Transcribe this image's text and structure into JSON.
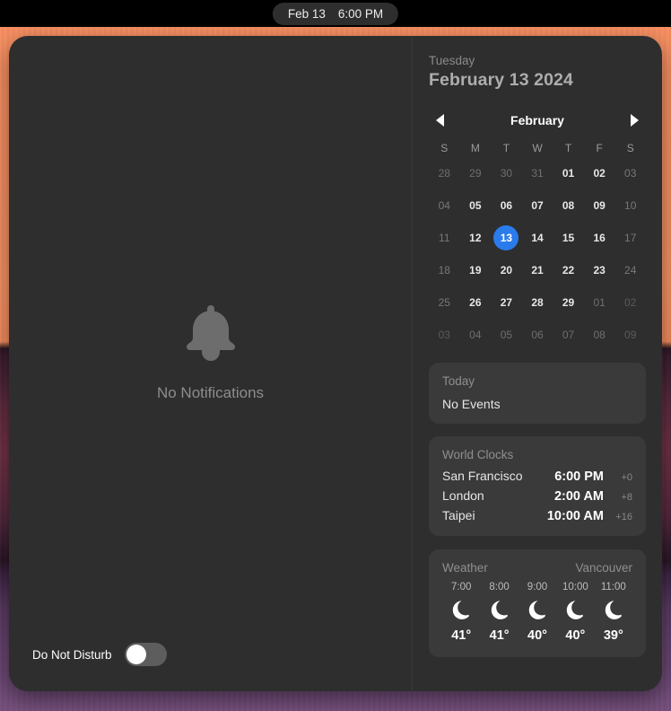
{
  "menubar": {
    "date": "Feb 13",
    "time": "6:00 PM"
  },
  "notifications": {
    "icon": "bell-icon",
    "empty_label": "No Notifications",
    "dnd_label": "Do Not Disturb",
    "dnd_state": "off"
  },
  "widgets": {
    "day_of_week": "Tuesday",
    "full_date": "February 13 2024",
    "calendar": {
      "prev_icon": "chevron-left-icon",
      "next_icon": "chevron-right-icon",
      "month": "February",
      "weekday_headers": [
        "S",
        "M",
        "T",
        "W",
        "T",
        "F",
        "S"
      ],
      "selected_day": "13",
      "accent_color": "#2a7bec",
      "weeks": [
        [
          {
            "d": "28",
            "style": "dim"
          },
          {
            "d": "29",
            "style": "dim"
          },
          {
            "d": "30",
            "style": "dim"
          },
          {
            "d": "31",
            "style": "dim"
          },
          {
            "d": "01",
            "style": "normal"
          },
          {
            "d": "02",
            "style": "normal"
          },
          {
            "d": "03",
            "style": "weekend"
          }
        ],
        [
          {
            "d": "04",
            "style": "weekend"
          },
          {
            "d": "05",
            "style": "normal"
          },
          {
            "d": "06",
            "style": "normal"
          },
          {
            "d": "07",
            "style": "normal"
          },
          {
            "d": "08",
            "style": "normal"
          },
          {
            "d": "09",
            "style": "normal"
          },
          {
            "d": "10",
            "style": "weekend"
          }
        ],
        [
          {
            "d": "11",
            "style": "weekend"
          },
          {
            "d": "12",
            "style": "normal"
          },
          {
            "d": "13",
            "style": "selected"
          },
          {
            "d": "14",
            "style": "normal"
          },
          {
            "d": "15",
            "style": "normal"
          },
          {
            "d": "16",
            "style": "normal"
          },
          {
            "d": "17",
            "style": "weekend"
          }
        ],
        [
          {
            "d": "18",
            "style": "weekend"
          },
          {
            "d": "19",
            "style": "normal"
          },
          {
            "d": "20",
            "style": "normal"
          },
          {
            "d": "21",
            "style": "normal"
          },
          {
            "d": "22",
            "style": "normal"
          },
          {
            "d": "23",
            "style": "normal"
          },
          {
            "d": "24",
            "style": "weekend"
          }
        ],
        [
          {
            "d": "25",
            "style": "weekend"
          },
          {
            "d": "26",
            "style": "normal"
          },
          {
            "d": "27",
            "style": "normal"
          },
          {
            "d": "28",
            "style": "normal"
          },
          {
            "d": "29",
            "style": "normal"
          },
          {
            "d": "01",
            "style": "dim"
          },
          {
            "d": "02",
            "style": "dimmer"
          }
        ],
        [
          {
            "d": "03",
            "style": "dimmer"
          },
          {
            "d": "04",
            "style": "dim"
          },
          {
            "d": "05",
            "style": "dim"
          },
          {
            "d": "06",
            "style": "dim"
          },
          {
            "d": "07",
            "style": "dim"
          },
          {
            "d": "08",
            "style": "dim"
          },
          {
            "d": "09",
            "style": "dimmer"
          }
        ]
      ]
    },
    "events": {
      "title": "Today",
      "body": "No Events"
    },
    "world_clocks": {
      "title": "World Clocks",
      "rows": [
        {
          "city": "San Francisco",
          "time": "6:00 PM",
          "offset": "+0"
        },
        {
          "city": "London",
          "time": "2:00 AM",
          "offset": "+8"
        },
        {
          "city": "Taipei",
          "time": "10:00 AM",
          "offset": "+16"
        }
      ]
    },
    "weather": {
      "title": "Weather",
      "city": "Vancouver",
      "forecast": [
        {
          "time": "7:00",
          "icon": "moon-icon",
          "temp": "41°"
        },
        {
          "time": "8:00",
          "icon": "moon-icon",
          "temp": "41°"
        },
        {
          "time": "9:00",
          "icon": "moon-icon",
          "temp": "40°"
        },
        {
          "time": "10:00",
          "icon": "moon-icon",
          "temp": "40°"
        },
        {
          "time": "11:00",
          "icon": "moon-icon",
          "temp": "39°"
        }
      ]
    }
  }
}
